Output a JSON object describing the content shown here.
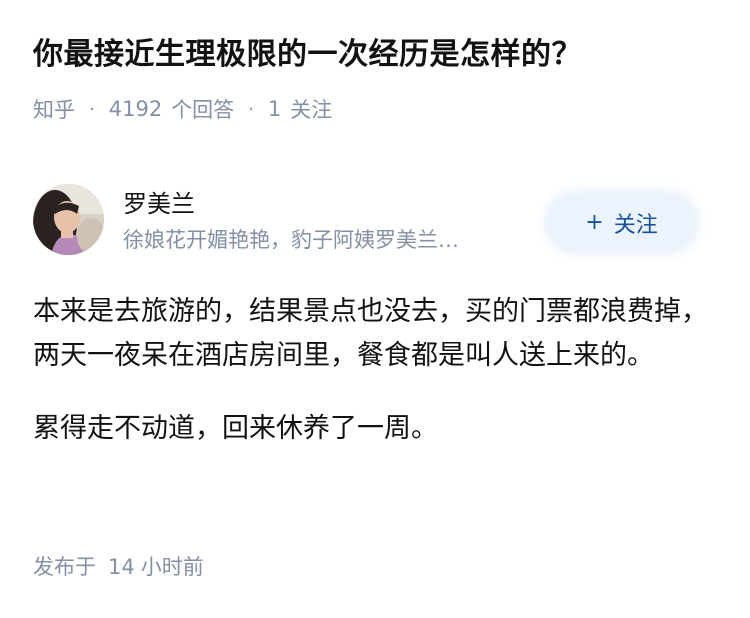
{
  "question": {
    "title": "你最接近生理极限的一次经历是怎样的？"
  },
  "meta": {
    "source": "知乎",
    "answer_count": "4192",
    "answer_label": "个回答",
    "follow_count": "1",
    "follow_label": "关注",
    "separator": "·"
  },
  "author": {
    "name": "罗美兰",
    "bio": "徐娘花开媚艳艳，豹子阿姨罗美兰…",
    "avatar_icon": "author-avatar",
    "follow_button": {
      "plus": "+",
      "label": "关注"
    }
  },
  "answer": {
    "paragraphs": [
      "本来是去旅游的，结果景点也没去，买的门票都浪费掉，两天一夜呆在酒店房间里，餐食都是叫人送上来的。",
      "累得走不动道，回来休养了一周。"
    ]
  },
  "footer": {
    "prefix": "发布于",
    "time_value": "14",
    "time_unit": "小时前"
  },
  "colors": {
    "title": "#121212",
    "meta": "#8590a6",
    "follow_bg": "#ebf3fd",
    "follow_text": "#175199"
  }
}
